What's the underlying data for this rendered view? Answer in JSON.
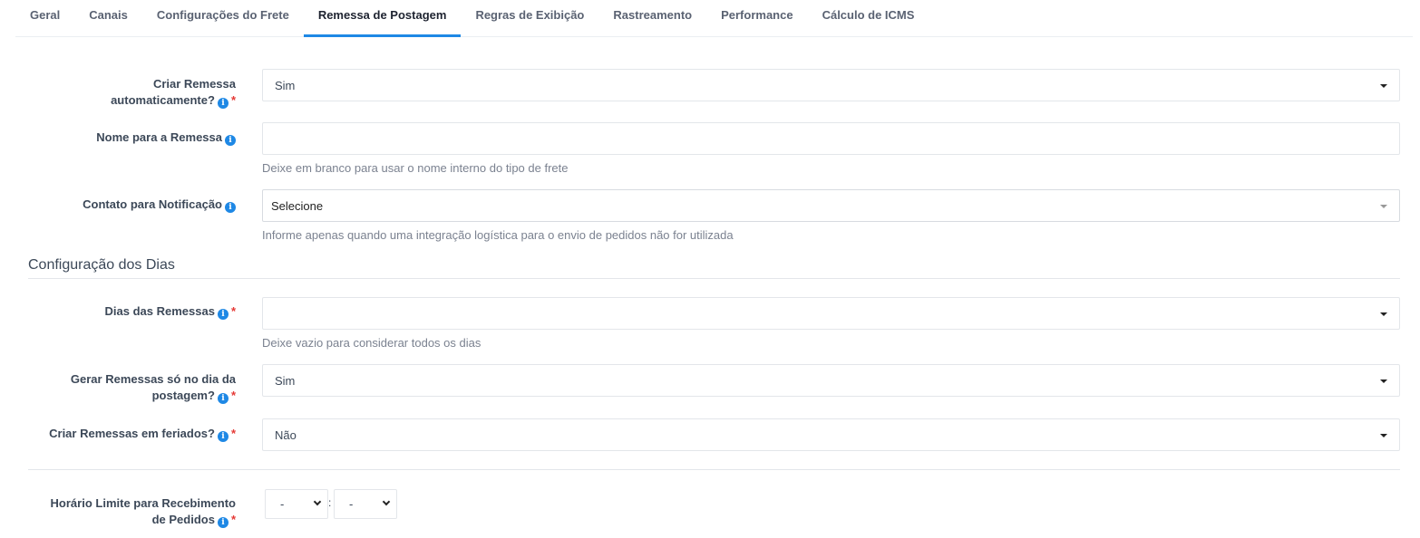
{
  "tabs": [
    {
      "label": "Geral"
    },
    {
      "label": "Canais"
    },
    {
      "label": "Configurações do Frete"
    },
    {
      "label": "Remessa de Postagem",
      "active": true
    },
    {
      "label": "Regras de Exibição"
    },
    {
      "label": "Rastreamento"
    },
    {
      "label": "Performance"
    },
    {
      "label": "Cálculo de ICMS"
    }
  ],
  "form": {
    "criar_remessa": {
      "label_line1": "Criar Remessa",
      "label_line2": "automaticamente?",
      "value": "Sim",
      "required_mark": "*"
    },
    "nome_remessa": {
      "label": "Nome para a Remessa",
      "value": "",
      "help": "Deixe em branco para usar o nome interno do tipo de frete"
    },
    "contato_notificacao": {
      "label": "Contato para Notificação",
      "value": "Selecione",
      "help": "Informe apenas quando uma integração logística para o envio de pedidos não for utilizada"
    }
  },
  "section": {
    "title": "Configuração dos Dias"
  },
  "dias": {
    "dias_remessas": {
      "label": "Dias das Remessas",
      "value": "",
      "help": "Deixe vazio para considerar todos os dias",
      "required_mark": "*"
    },
    "gerar_remessas": {
      "label_line1": "Gerar Remessas só no dia da",
      "label_line2": "postagem?",
      "value": "Sim",
      "required_mark": "*"
    },
    "feriados": {
      "label": "Criar Remessas em feriados?",
      "value": "Não",
      "required_mark": "*"
    },
    "horario": {
      "label_line1": "Horário Limite para Recebimento",
      "label_line2": "de Pedidos",
      "hour": "-",
      "minute": "-",
      "separator": ":",
      "required_mark": "*"
    }
  },
  "icons": {
    "info": "info-icon",
    "dropdown": "caret-down-icon"
  },
  "colors": {
    "accent": "#1e88e5",
    "required": "#e53935"
  }
}
